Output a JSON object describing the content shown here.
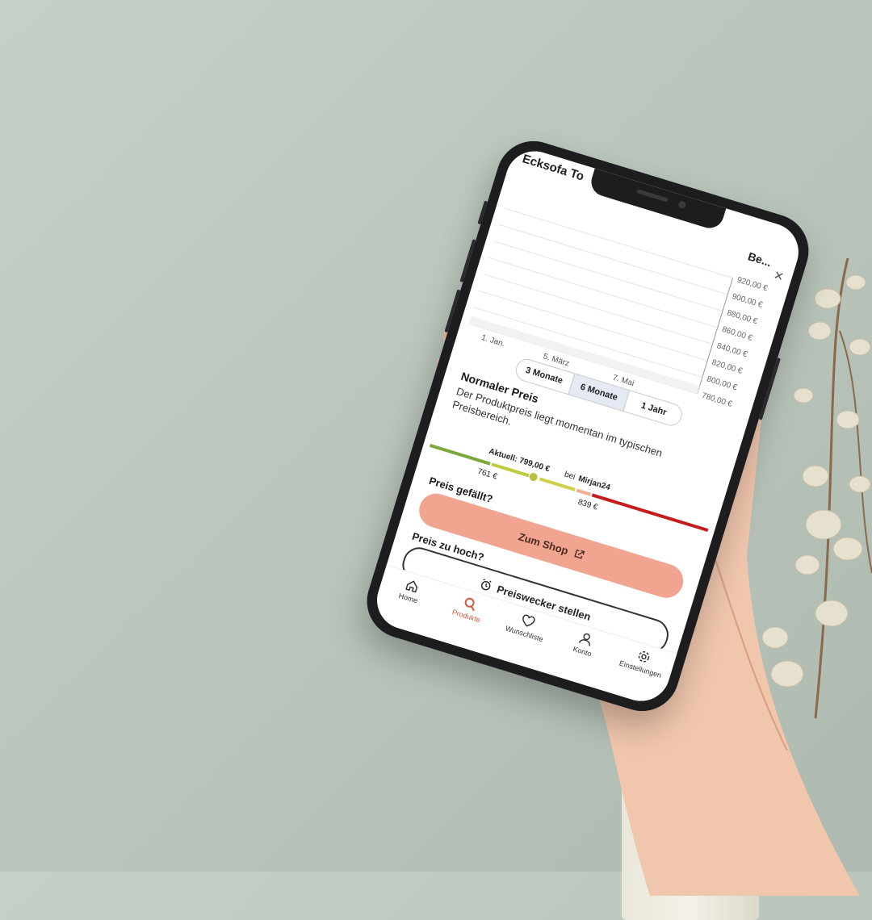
{
  "product": {
    "title": "Ecksofa To",
    "title_right": "Be..."
  },
  "chart_data": {
    "type": "line",
    "x_ticks": [
      "1. Jan.",
      "5. März",
      "7. Mai"
    ],
    "y_ticks": [
      "920,00 €",
      "900,00 €",
      "880,00 €",
      "860,00 €",
      "840,00 €",
      "820,00 €",
      "800,00 €",
      "780,00 €"
    ],
    "ylim": [
      780,
      920
    ],
    "grid": true
  },
  "range": {
    "options": [
      "3 Monate",
      "6 Monate",
      "1 Jahr"
    ],
    "selected": "6 Monate"
  },
  "price_status": {
    "heading": "Normaler Preis",
    "description": "Der Produktpreis liegt momentan im typischen Preisbereich."
  },
  "price_bar": {
    "current_label": "Aktuell: 799,00 €",
    "shop_prefix": "bei",
    "shop_name": "Mirjan24",
    "low": "761 €",
    "high": "839 €"
  },
  "actions": {
    "like_heading": "Preis gefällt?",
    "shop_button": "Zum Shop",
    "too_high_heading": "Preis zu hoch?",
    "alarm_button": "Preiswecker stellen"
  },
  "tabs": [
    {
      "label": "Home",
      "icon": "home-icon"
    },
    {
      "label": "Produkte",
      "icon": "search-icon",
      "active": true
    },
    {
      "label": "Wunschliste",
      "icon": "heart-icon"
    },
    {
      "label": "Konto",
      "icon": "user-icon"
    },
    {
      "label": "Einstellungen",
      "icon": "gear-icon"
    }
  ],
  "colors": {
    "accent": "#f1a48f",
    "active_tab": "#d25a3a"
  }
}
